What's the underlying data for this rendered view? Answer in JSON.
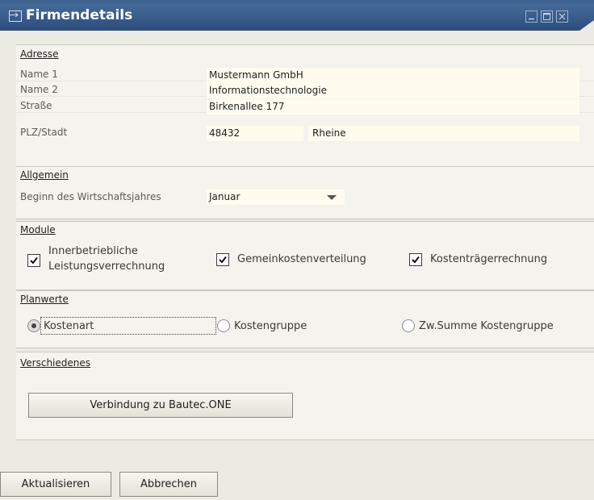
{
  "window": {
    "title": "Firmendetails",
    "icon": "form-icon"
  },
  "titlebar_controls": [
    "minimize-icon",
    "maximize-icon",
    "close-icon"
  ],
  "address": {
    "title": "Adresse",
    "name1_label": "Name 1",
    "name1_value": "Mustermann GmbH",
    "name2_label": "Name 2",
    "name2_value": "Informationstechnologie",
    "street_label": "Straße",
    "street_value": "Birkenallee 177",
    "city_label": "PLZ/Stadt",
    "zip_value": "48432",
    "city_value": "Rheine"
  },
  "general": {
    "title": "Allgemein",
    "fiscal_label": "Beginn des Wirtschaftsjahres",
    "fiscal_value": "Januar"
  },
  "modules": {
    "title": "Module",
    "items": [
      {
        "label_line1": "Innerbetriebliche",
        "label_line2": "Leistungsverrechnung",
        "checked": true
      },
      {
        "label": "Gemeinkostenverteilung",
        "checked": true
      },
      {
        "label": "Kostenträgerrechnung",
        "checked": true
      }
    ]
  },
  "planwerte": {
    "title": "Planwerte",
    "options": [
      {
        "label": "Kostenart",
        "selected": true
      },
      {
        "label": "Kostengruppe",
        "selected": false
      },
      {
        "label": "Zw.Summe Kostengruppe",
        "selected": false
      }
    ]
  },
  "misc": {
    "title": "Verschiedenes",
    "connect_button": "Verbindung zu Bautec.ONE"
  },
  "footer": {
    "update_button": "Aktualisieren",
    "cancel_button": "Abbrechen"
  },
  "colors": {
    "titlebar": "#2b4d7c",
    "field_background": "#fffcef",
    "window_background": "#ecebe3"
  }
}
